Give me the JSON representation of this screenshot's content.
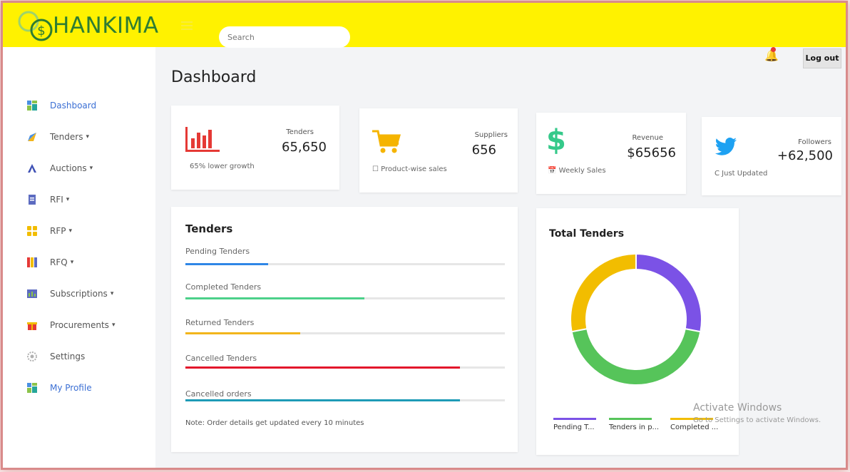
{
  "header": {
    "brand": "HANKIMA",
    "search_placeholder": "Search",
    "logout_label": "Log out"
  },
  "sidebar": {
    "items": [
      {
        "label": "Dashboard",
        "icon": "dashboard-icon",
        "active": true,
        "caret": ""
      },
      {
        "label": "Tenders",
        "icon": "tenders-icon",
        "caret": "▾"
      },
      {
        "label": "Auctions",
        "icon": "auctions-icon",
        "caret": "▾"
      },
      {
        "label": "RFI",
        "icon": "document-icon",
        "caret": "▾"
      },
      {
        "label": "RFP",
        "icon": "grid-icon",
        "caret": "▾"
      },
      {
        "label": "RFQ",
        "icon": "books-icon",
        "caret": "▾"
      },
      {
        "label": "Subscriptions",
        "icon": "subscriptions-icon",
        "caret": "▾"
      },
      {
        "label": "Procurements",
        "icon": "gift-icon",
        "caret": "▾"
      },
      {
        "label": "Settings",
        "icon": "gear-icon",
        "caret": ""
      },
      {
        "label": "My Profile",
        "icon": "profile-icon",
        "active": true,
        "caret": ""
      }
    ]
  },
  "main": {
    "title": "Dashboard",
    "stats": [
      {
        "label": "Tenders",
        "value": "65,650",
        "sub": "65% lower growth",
        "icon": "bar-chart-icon",
        "color": "#e53935"
      },
      {
        "label": "Suppliers",
        "value": "656",
        "sub": "Product-wise sales",
        "sub_icon": "bookmark-icon",
        "icon": "cart-icon",
        "color": "#f5b400"
      },
      {
        "label": "Revenue",
        "value": "$65656",
        "sub": "Weekly Sales",
        "sub_icon": "calendar-icon",
        "icon": "dollar-icon",
        "color": "#35c98a"
      },
      {
        "label": "Followers",
        "value": "+62,500",
        "sub": "Just Updated",
        "sub_icon": "refresh-icon",
        "icon": "twitter-icon",
        "color": "#1da1f2"
      }
    ],
    "tenders_panel": {
      "title": "Tenders",
      "rows": [
        {
          "label": "Pending Tenders",
          "progress": 0.26,
          "color": "#2f86e6"
        },
        {
          "label": "Completed Tenders",
          "progress": 0.56,
          "color": "#4cd08a"
        },
        {
          "label": "Returned Tenders",
          "progress": 0.36,
          "color": "#f2b51b"
        },
        {
          "label": "Cancelled Tenders",
          "progress": 0.86,
          "color": "#e3152b"
        },
        {
          "label": "Cancelled orders",
          "progress": 0.86,
          "color": "#1e9bb6"
        }
      ],
      "note": "Note: Order details get updated every 10 minutes"
    },
    "total_tenders": {
      "title": "Total Tenders",
      "legend": [
        {
          "label": "Pending T...",
          "color": "#7b52e6"
        },
        {
          "label": "Tenders in p...",
          "color": "#56c45a"
        },
        {
          "label": "Completed ...",
          "color": "#f2bd00"
        }
      ]
    }
  },
  "chart_data": {
    "type": "pie",
    "title": "Total Tenders",
    "categories": [
      "Pending T...",
      "Tenders in p...",
      "Completed ..."
    ],
    "values": [
      28,
      44,
      28
    ],
    "colors": [
      "#7b52e6",
      "#56c45a",
      "#f2bd00"
    ],
    "legend_position": "bottom"
  },
  "overlay": {
    "activate_title": "Activate Windows",
    "activate_sub": "Go to Settings to activate Windows."
  }
}
